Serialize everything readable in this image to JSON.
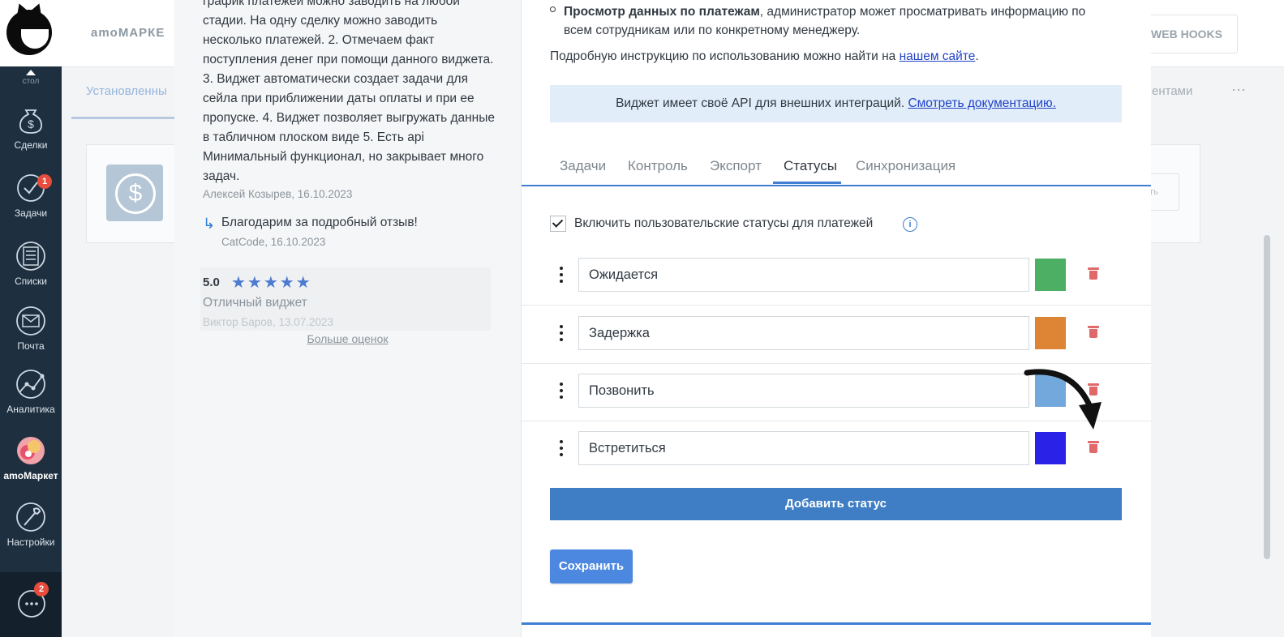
{
  "sidebar": {
    "up_label": "стол",
    "items": [
      {
        "label": "Сделки",
        "badge": ""
      },
      {
        "label": "Задачи",
        "badge": "1"
      },
      {
        "label": "Списки",
        "badge": ""
      },
      {
        "label": "Почта",
        "badge": ""
      },
      {
        "label": "Аналитика",
        "badge": ""
      },
      {
        "label": "amoМаркет",
        "badge": ""
      },
      {
        "label": "Настройки",
        "badge": ""
      }
    ],
    "chat_badge": "2"
  },
  "background": {
    "brand": "amoМАРКЕ",
    "webhooks": "WEB HOOKS",
    "tab_installed": "Установленны",
    "tab_right": "ентами",
    "more": "···",
    "card_button": "ть",
    "dollar": "$"
  },
  "review": {
    "text": "график платежей можно заводить на любой стадии. На одну сделку можно заводить несколько платежей. 2. Отмечаем факт поступления денег при помощи данного виджета. 3. Виджет автоматически создает задачи для сейла при приближении даты оплаты и при ее пропуске. 4. Виджет позволяет выгружать данные в табличном плоском виде 5. Есть api Минимальный функционал, но закрывает много задач.",
    "author": "Алексей Козырев, 16.10.2023",
    "reply_text": "Благодарим за подробный отзыв!",
    "reply_author": "CatCode, 16.10.2023",
    "rating_score": "5.0",
    "stars": "★★★★★",
    "rating_title": "Отличный виджет",
    "rating_author": "Виктор Баров, 13.07.2023",
    "more_ratings": "Больше оценок"
  },
  "content": {
    "payments_bold": "Просмотр данных по платежам",
    "payments_rest": ", администратор может просматривать информацию по",
    "payments_line2": "всем сотрудникам или по конкретному менеджеру.",
    "instruction_text": "Подробную инструкцию по использованию можно найти на ",
    "instruction_link": "нашем сайте",
    "instruction_end": ".",
    "api_text": "Виджет имеет своё API для внешних интеграций. ",
    "api_link": "Смотреть документацию."
  },
  "tabs": [
    {
      "label": "Задачи",
      "active": false
    },
    {
      "label": "Контроль",
      "active": false
    },
    {
      "label": "Экспорт",
      "active": false
    },
    {
      "label": "Статусы",
      "active": true
    },
    {
      "label": "Синхронизация",
      "active": false
    }
  ],
  "enable_statuses": {
    "checked": true,
    "label": "Включить пользовательские статусы для платежей",
    "info_icon": "i"
  },
  "statuses": [
    {
      "value": "Ожидается",
      "color": "#4caf64"
    },
    {
      "value": "Задержка",
      "color": "#dd8535"
    },
    {
      "value": "Позвонить",
      "color": "#73a8dc"
    },
    {
      "value": "Встретиться",
      "color": "#2a22e6"
    }
  ],
  "buttons": {
    "add_status": "Добавить статус",
    "save": "Сохранить"
  }
}
